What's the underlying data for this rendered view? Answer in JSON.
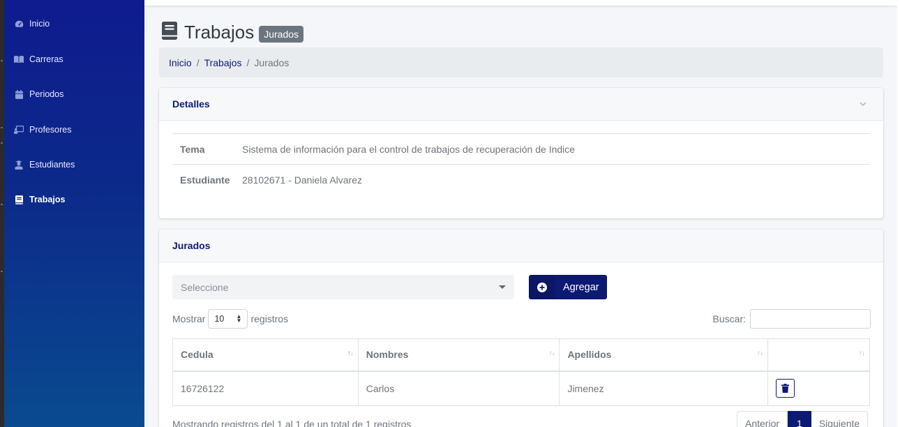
{
  "sidebar": {
    "items": [
      {
        "label": "Inicio",
        "icon": "tachometer-icon"
      },
      {
        "label": "Carreras",
        "icon": "book-open-icon"
      },
      {
        "label": "Periodos",
        "icon": "calendar-icon"
      },
      {
        "label": "Profesores",
        "icon": "chalkboard-teacher-icon"
      },
      {
        "label": "Estudiantes",
        "icon": "user-graduate-icon"
      },
      {
        "label": "Trabajos",
        "icon": "book-icon",
        "active": true
      }
    ]
  },
  "header": {
    "title": "Trabajos",
    "badge": "Jurados",
    "icon": "book-icon"
  },
  "breadcrumb": {
    "items": [
      "Inicio",
      "Trabajos",
      "Jurados"
    ],
    "separator": "/"
  },
  "details": {
    "title": "Detalles",
    "rows": [
      {
        "label": "Tema",
        "value": "Sistema de información para el control de trabajos de recuperación de Indice"
      },
      {
        "label": "Estudiante",
        "value": "28102671 - Daniela Alvarez"
      }
    ]
  },
  "jurados": {
    "title": "Jurados",
    "select_placeholder": "Seleccione",
    "add_label": "Agregar",
    "show_label": "Mostrar",
    "show_value": "10",
    "records_label": "registros",
    "search_label": "Buscar:",
    "search_value": "",
    "columns": [
      "Cedula",
      "Nombres",
      "Apellidos",
      ""
    ],
    "rows": [
      {
        "cedula": "16726122",
        "nombres": "Carlos",
        "apellidos": "Jimenez"
      }
    ],
    "info": "Mostrando registros del 1 al 1 de un total de 1 registros",
    "pagination": {
      "prev": "Anterior",
      "current": "1",
      "next": "Siguiente"
    }
  },
  "colors": {
    "accent": "#0d1a73",
    "sidebar_top": "#0f1b8e",
    "sidebar_bottom": "#0a4a8f",
    "badge": "#6c757d"
  }
}
